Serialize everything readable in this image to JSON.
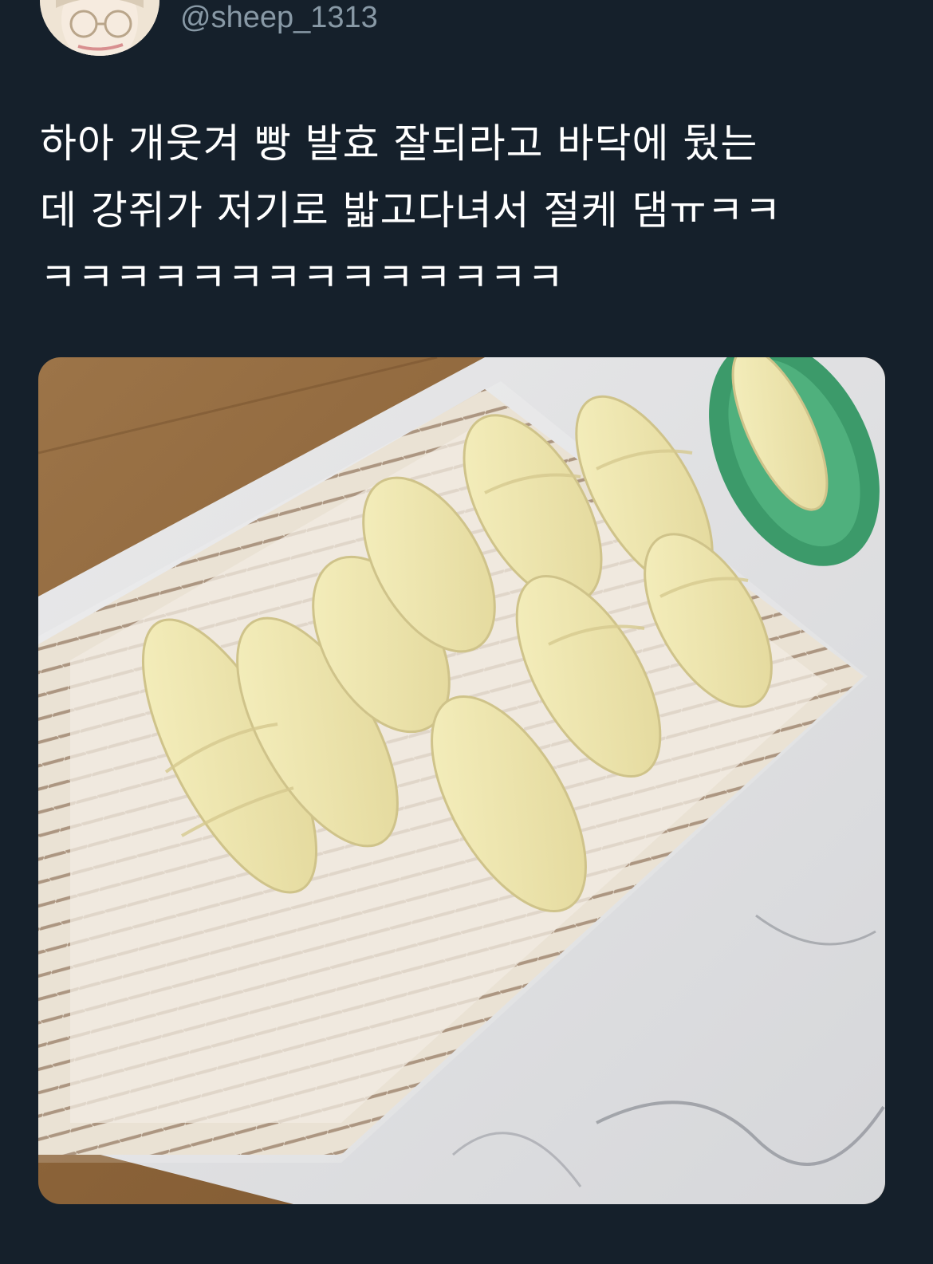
{
  "tweet": {
    "handle": "@sheep_1313",
    "text_lines": [
      "하아 개웃겨 빵 발효 잘되라고 바닥에 뒀는",
      "데 강쥐가 저기로 밟고다녀서 절케 댐ㅠㅋㅋ",
      "ㅋㅋㅋㅋㅋㅋㅋㅋㅋㅋㅋㅋㅋㅋ"
    ]
  },
  "media": {
    "icon": "photo-croissant-dough-tray"
  },
  "colors": {
    "background": "#15202b",
    "handle": "#8899a6",
    "text": "#ffffff"
  }
}
